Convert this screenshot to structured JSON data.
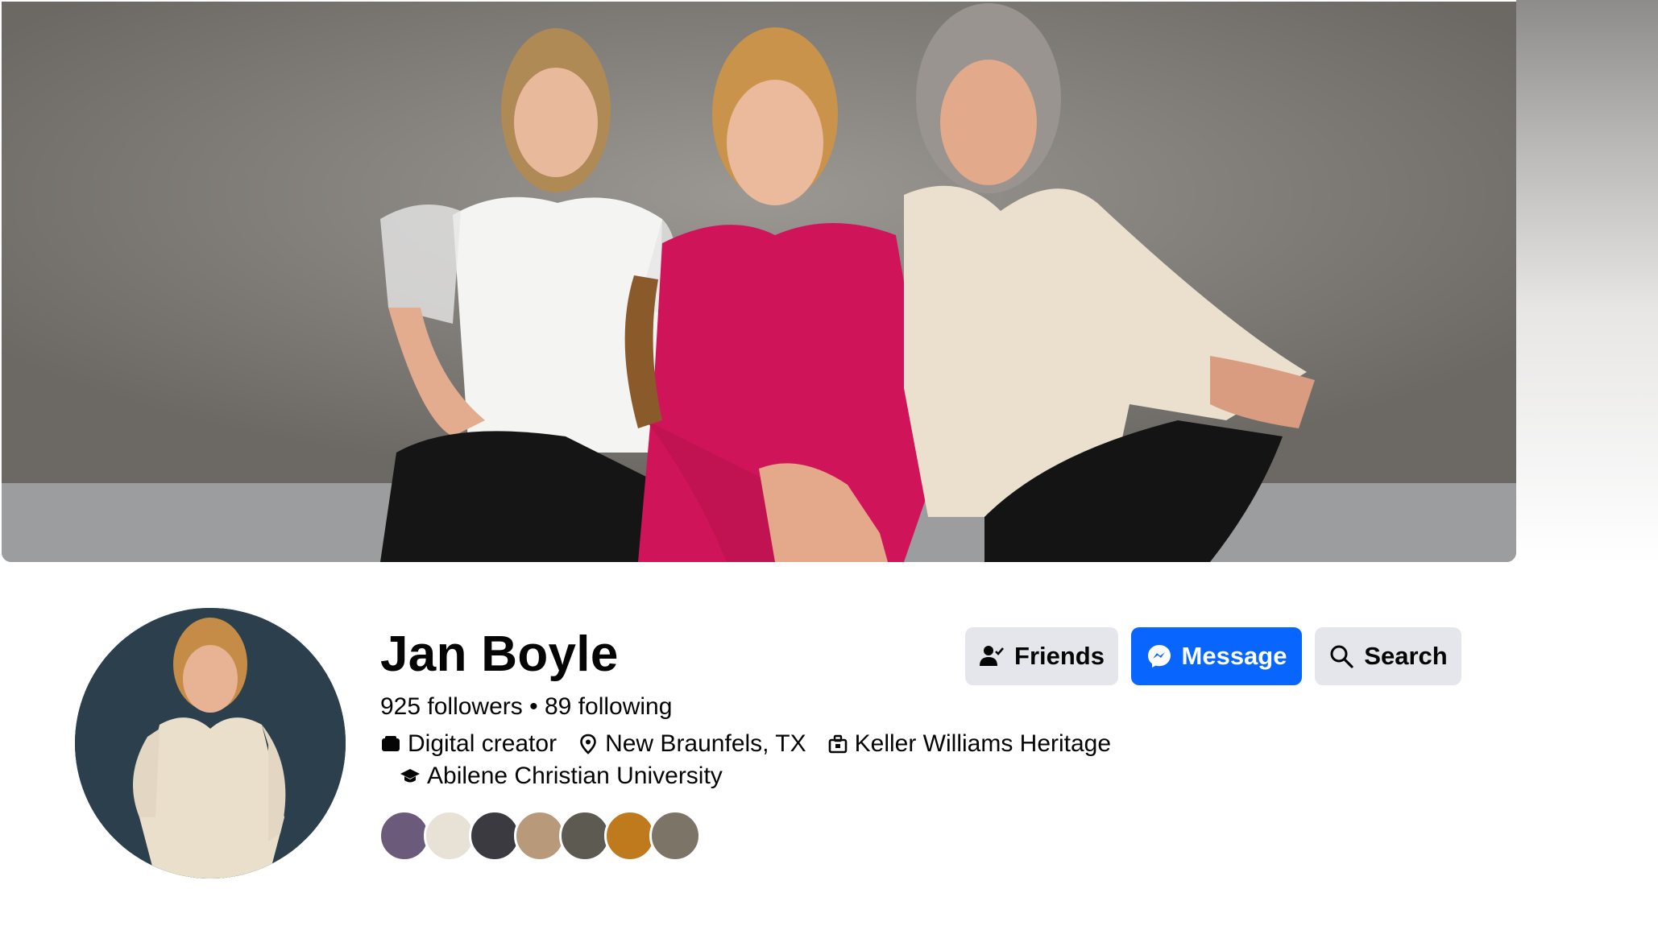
{
  "profile": {
    "name": "Jan Boyle",
    "followers": "925 followers",
    "separator": "•",
    "following": "89 following",
    "intro": {
      "category": "Digital creator",
      "location": "New Braunfels, TX",
      "work": "Keller Williams Heritage",
      "education": "Abilene Christian University"
    }
  },
  "actions": {
    "friends_label": "Friends",
    "message_label": "Message",
    "search_label": "Search"
  },
  "colors": {
    "primary_blue": "#0866ff",
    "secondary_button": "#e4e6eb",
    "text": "#050505"
  },
  "icons": {
    "friends": "person-check-icon",
    "message": "messenger-icon",
    "search": "search-icon",
    "category": "category-icon",
    "location": "map-pin-icon",
    "work": "briefcase-icon",
    "education": "graduation-cap-icon"
  },
  "mutual_friends": [
    {
      "name": "friend-avatar-1",
      "color": "#6b5a7a"
    },
    {
      "name": "friend-avatar-2",
      "color": "#e8e2d6"
    },
    {
      "name": "friend-avatar-3",
      "color": "#3a3a40"
    },
    {
      "name": "friend-avatar-4",
      "color": "#b89a7a"
    },
    {
      "name": "friend-avatar-5",
      "color": "#5d5a52"
    },
    {
      "name": "friend-avatar-6",
      "color": "#c07a1e"
    },
    {
      "name": "friend-avatar-7",
      "color": "#7d7468"
    }
  ]
}
